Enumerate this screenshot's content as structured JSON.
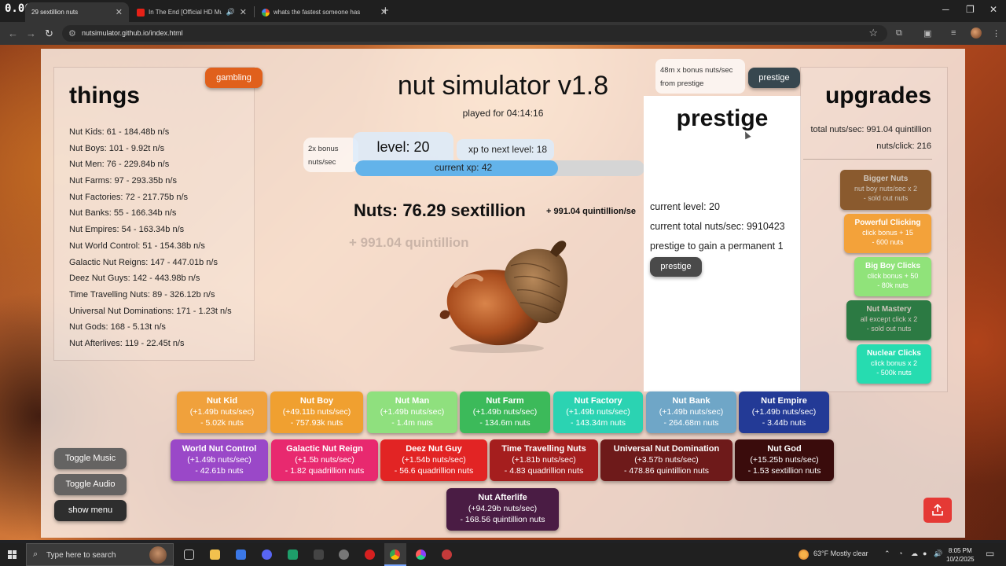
{
  "recording_counter": "0.00",
  "browser": {
    "tabs": [
      {
        "title": "29 sextillion nuts",
        "active": true
      },
      {
        "title": "In The End [Official HD Music",
        "active": false
      },
      {
        "title": "whats the fastest someone has",
        "active": false
      }
    ],
    "new_tab": "+",
    "url": "nutsimulator.github.io/index.html"
  },
  "things": {
    "title": "things",
    "items": [
      "Nut Kids: 61 - 184.48b n/s",
      "Nut Boys: 101 - 9.92t n/s",
      "Nut Men: 76 - 229.84b n/s",
      "Nut Farms: 97 - 293.35b n/s",
      "Nut Factories: 72 - 217.75b n/s",
      "Nut Banks: 55 - 166.34b n/s",
      "Nut Empires: 54 - 163.34b n/s",
      "Nut World Control: 51 - 154.38b n/s",
      "Galactic Nut Reigns: 147 - 447.01b n/s",
      "Deez Nut Guys: 142 - 443.98b n/s",
      "Time Travelling Nuts: 89 - 326.12b n/s",
      "Universal Nut Dominations: 171 - 1.23t n/s",
      "Nut Gods: 168 - 5.13t n/s",
      "Nut Afterlives: 119 - 22.45t n/s"
    ]
  },
  "gambling_label": "gambling",
  "game": {
    "title": "nut simulator v1.8",
    "played_for": "played for 04:14:16",
    "bonus_tip": [
      "2x bonus",
      "nuts/sec"
    ],
    "level": "level: 20",
    "xp_to_next": "xp to next level: 18",
    "current_xp": "current xp: 42",
    "xp_progress": 0.7,
    "nuts": "Nuts: 76.29 sextillion",
    "nuts_rate": "+ 991.04 quintillion/se",
    "floating_gain": "+ 991.04 quintillion"
  },
  "prestige": {
    "tip": [
      "48m x bonus nuts/sec",
      "from prestige"
    ],
    "top_button": "prestige",
    "title": "prestige",
    "current_level": "current level: 20",
    "current_total": "current total nuts/sec: 9910423",
    "gain_text": "prestige to gain a permanent 1",
    "button": "prestige"
  },
  "upgrades": {
    "title": "upgrades",
    "total": "total nuts/sec: 991.04 quintillion",
    "per_click": "nuts/click: 216",
    "items": [
      {
        "name": "Bigger Nuts",
        "l1": "nut boy nuts/sec x 2",
        "l2": "- sold out nuts",
        "color": "#8a5a2e",
        "sold_out": true
      },
      {
        "name": "Powerful Clicking",
        "l1": "click bonus + 15",
        "l2": "- 600 nuts",
        "color": "#f3a23a",
        "sold_out": false
      },
      {
        "name": "Big Boy Clicks",
        "l1": "click bonus + 50",
        "l2": "- 80k nuts",
        "color": "#90e37a",
        "sold_out": false
      },
      {
        "name": "Nut Mastery",
        "l1": "all except click x 2",
        "l2": "- sold out nuts",
        "color": "#2c7a43",
        "sold_out": true
      },
      {
        "name": "Nuclear Clicks",
        "l1": "click bonus x 2",
        "l2": "- 500k nuts",
        "color": "#26dcb0",
        "sold_out": false
      }
    ]
  },
  "shop": [
    {
      "name": "Nut Kid",
      "rate": "(+1.49b nuts/sec)",
      "cost": "- 5.02k nuts",
      "color": "#f0a13c"
    },
    {
      "name": "Nut Boy",
      "rate": "(+49.11b nuts/sec)",
      "cost": "- 757.93k nuts",
      "color": "#f0a030"
    },
    {
      "name": "Nut Man",
      "rate": "(+1.49b nuts/sec)",
      "cost": "- 1.4m nuts",
      "color": "#8fe07e"
    },
    {
      "name": "Nut Farm",
      "rate": "(+1.49b nuts/sec)",
      "cost": "- 134.6m nuts",
      "color": "#3cba5a"
    },
    {
      "name": "Nut Factory",
      "rate": "(+1.49b nuts/sec)",
      "cost": "- 143.34m nuts",
      "color": "#2bd3b2"
    },
    {
      "name": "Nut Bank",
      "rate": "(+1.49b nuts/sec)",
      "cost": "- 264.68m nuts",
      "color": "#6fa6c7"
    },
    {
      "name": "Nut Empire",
      "rate": "(+1.49b nuts/sec)",
      "cost": "- 3.44b nuts",
      "color": "#233a96"
    },
    {
      "name": "World Nut Control",
      "rate": "(+1.49b nuts/sec)",
      "cost": "- 42.61b nuts",
      "color": "#9a48c8"
    },
    {
      "name": "Galactic Nut Reign",
      "rate": "(+1.5b nuts/sec)",
      "cost": "- 1.82 quadrillion nuts",
      "color": "#e8296f"
    },
    {
      "name": "Deez Nut Guy",
      "rate": "(+1.54b nuts/sec)",
      "cost": "- 56.6 quadrillion nuts",
      "color": "#e22424"
    },
    {
      "name": "Time Travelling Nuts",
      "rate": "(+1.81b nuts/sec)",
      "cost": "- 4.83 quadrillion nuts",
      "color": "#a51e1e"
    },
    {
      "name": "Universal Nut Domination",
      "rate": "(+3.57b nuts/sec)",
      "cost": "- 478.86 quintillion nuts",
      "color": "#6e1a1a"
    },
    {
      "name": "Nut God",
      "rate": "(+15.25b nuts/sec)",
      "cost": "- 1.53 sextillion nuts",
      "color": "#3a0c0c"
    },
    {
      "name": "Nut Afterlife",
      "rate": "(+94.29b nuts/sec)",
      "cost": "- 168.56 quintillion nuts",
      "color": "#4a1c44"
    }
  ],
  "side_buttons": {
    "music": "Toggle Music",
    "audio": "Toggle Audio",
    "menu": "show menu"
  },
  "taskbar": {
    "search_placeholder": "Type here to search",
    "weather": "63°F  Mostly clear",
    "time": "8:05 PM",
    "date": "10/2/2025"
  }
}
